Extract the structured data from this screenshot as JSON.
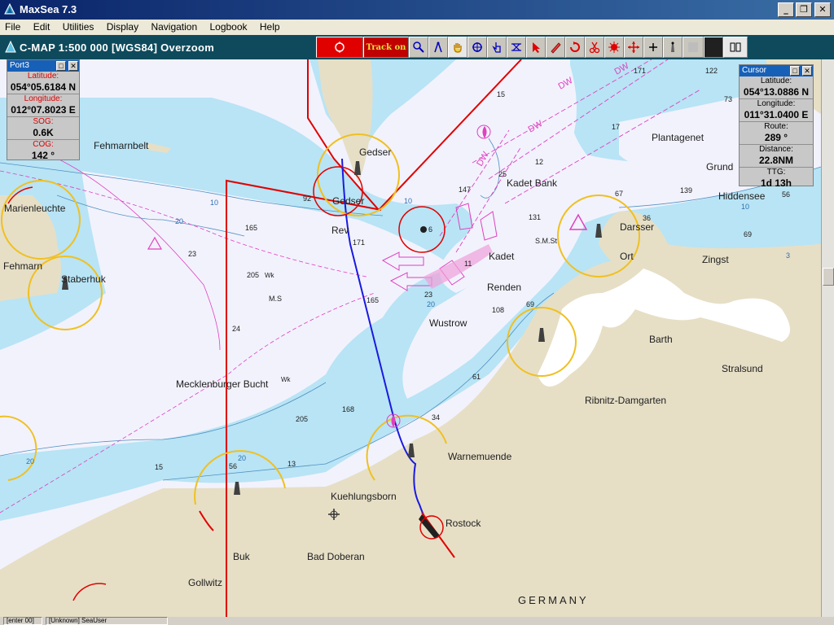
{
  "window": {
    "title": "MaxSea 7.3",
    "minimize": "_",
    "maximize": "❐",
    "close": "✕"
  },
  "menu": [
    "File",
    "Edit",
    "Utilities",
    "Display",
    "Navigation",
    "Logbook",
    "Help"
  ],
  "chart_header": {
    "info": "C-MAP  1:500 000 [WGS84]    Overzoom"
  },
  "toolbar": {
    "track_label": "Track on"
  },
  "port_panel": {
    "title": "Port3",
    "fields": [
      {
        "label": "Latitude:",
        "value": "054°05.6184 N"
      },
      {
        "label": "Longitude:",
        "value": "012°07.8023 E"
      },
      {
        "label": "SOG:",
        "value": "0.6K"
      },
      {
        "label": "COG:",
        "value": "142 °"
      }
    ]
  },
  "cursor_panel": {
    "title": "Cursor",
    "fields": [
      {
        "label": "Latitude:",
        "value": "054°13.0886 N"
      },
      {
        "label": "Longitude:",
        "value": "011°31.0400 E"
      },
      {
        "label": "Route:",
        "value": "289 °"
      },
      {
        "label": "Distance:",
        "value": "22.8NM"
      },
      {
        "label": "TTG:",
        "value": "1d 13h"
      }
    ]
  },
  "places": {
    "fehmarnbelt": "Fehmarnbelt",
    "gedser": "Gedser",
    "gedser2": "Gedser",
    "rev": "Rev",
    "kadet_bank": "Kadet Bank",
    "kadet": "Kadet",
    "renden": "Renden",
    "wustrow": "Wustrow",
    "plantagenet": "Plantagenet",
    "grund": "Grund",
    "hiddensee": "Hiddensee",
    "darsser": "Darsser",
    "ort": "Ort",
    "zingst": "Zingst",
    "barth": "Barth",
    "stralsund": "Stralsund",
    "ribnitz": "Ribnitz-Damgarten",
    "warnemuende": "Warnemuende",
    "kuehlungsborn": "Kuehlungsborn",
    "rostock": "Rostock",
    "bad_doberan": "Bad Doberan",
    "buk": "Buk",
    "gollwitz": "Gollwitz",
    "germany": "GERMANY",
    "mecklenburger": "Mecklenburger Bucht",
    "staberhuk": "Staberhuk",
    "marienleuchte": "Marienleuchte",
    "fehmarn": "Fehmarn",
    "ms": "M.S",
    "sms": "S.M.St",
    "wk": "Wk",
    "wk2": "Wk",
    "dw1": "DW",
    "dw2": "DW",
    "dw3": "DW",
    "dw4": "DW"
  },
  "depths": {
    "d15a": "15",
    "d17": "17",
    "d171": "171",
    "d122": "122",
    "d73": "73",
    "d12": "12",
    "d25": "25",
    "d147": "147",
    "d131": "131",
    "d67": "67",
    "d36": "36",
    "d56": "56",
    "d139": "139",
    "d69": "69",
    "d165": "165",
    "d23": "23",
    "d171b": "171",
    "d205": "205",
    "d24": "24",
    "d165b": "165",
    "d11": "11",
    "d108": "108",
    "d69b": "69",
    "d61": "61",
    "d168": "168",
    "d205b": "205",
    "d34": "34",
    "d15b": "15",
    "d13": "13",
    "d56b": "56",
    "d23b": "23",
    "d6": "6",
    "d10a": "10",
    "d10b": "10",
    "d20a": "20",
    "d20b": "20",
    "d20c": "20",
    "d20d": "20",
    "d3": "3",
    "d10c": "10",
    "d92": "92"
  },
  "statusbar": {
    "left": "[enter 00]",
    "user": "[Unknown] SeaUser"
  }
}
